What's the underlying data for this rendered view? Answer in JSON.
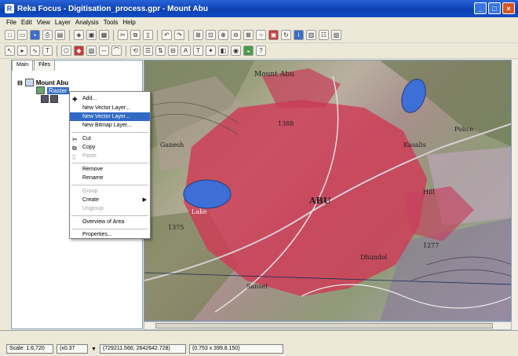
{
  "window": {
    "title": "Reka Focus - Digitisation_process.gpr - Mount Abu"
  },
  "menu": [
    "File",
    "Edit",
    "View",
    "Layer",
    "Analysis",
    "Tools",
    "Help"
  ],
  "panel": {
    "tabs": [
      "Main",
      "Files"
    ],
    "root_label": "Mount Abu",
    "layer_label": "Raster"
  },
  "context_menu": {
    "items": [
      {
        "label": "Add...",
        "state": "normal",
        "icon": "add-icon"
      },
      {
        "label": "New Vector Layer...",
        "state": "normal"
      },
      {
        "label": "New Vector Layer...",
        "state": "selected"
      },
      {
        "label": "New Bitmap Layer...",
        "state": "normal"
      },
      {
        "label": "Cut",
        "state": "normal",
        "icon": "scissors-icon"
      },
      {
        "label": "Copy",
        "state": "normal",
        "icon": "copy-icon"
      },
      {
        "label": "Paste",
        "state": "disabled",
        "icon": "paste-icon"
      },
      {
        "label": "Remove",
        "state": "normal"
      },
      {
        "label": "Rename",
        "state": "normal"
      },
      {
        "label": "Group",
        "state": "disabled"
      },
      {
        "label": "Create",
        "state": "normal",
        "submenu": true
      },
      {
        "label": "Ungroup",
        "state": "disabled"
      },
      {
        "label": "Overview of Area",
        "state": "normal"
      },
      {
        "label": "Properties...",
        "state": "normal"
      }
    ]
  },
  "map": {
    "labels": [
      "ABU",
      "Sanset",
      "Mount Abu",
      "1375",
      "1277",
      "1388",
      "Dhundol",
      "Lake",
      "Ganesh",
      "Kasalis",
      "Hill",
      "Police"
    ]
  },
  "status": {
    "scale": "Scale: 1:6,720",
    "zoom": "(x0.37",
    "coords": "(729211.566, 2642642.728)",
    "extent": "(0.753 x 399.8.150)"
  }
}
